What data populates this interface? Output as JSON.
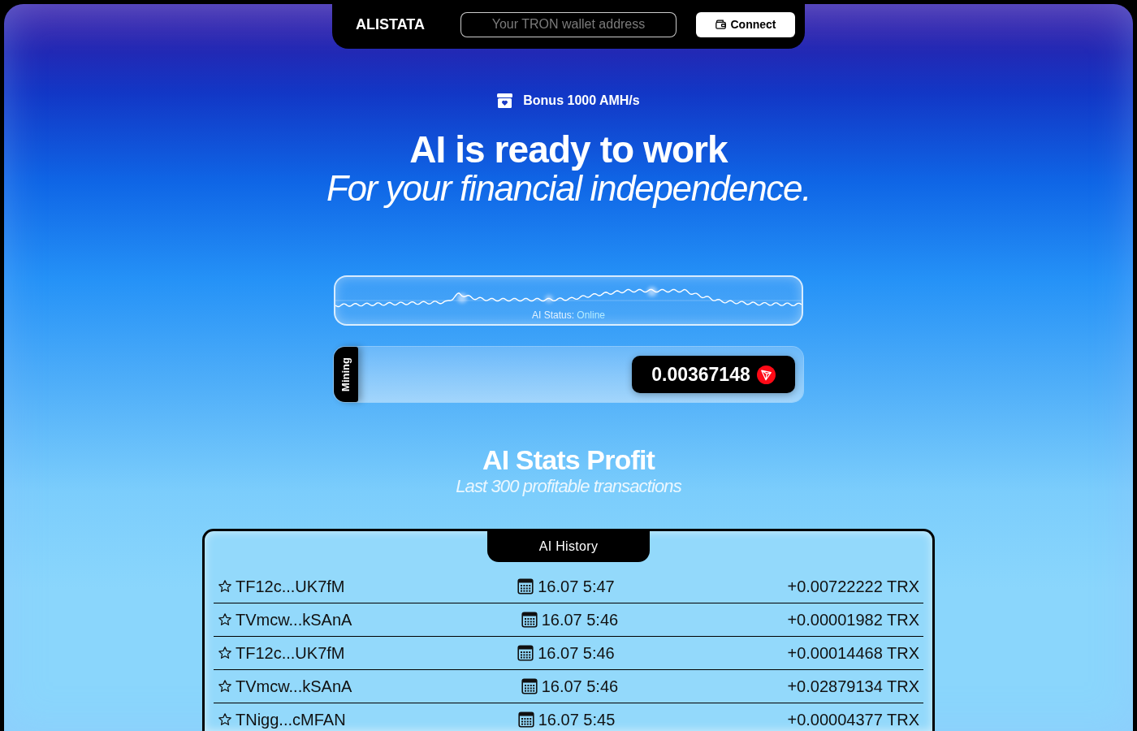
{
  "header": {
    "logo": "ALISTATA",
    "wallet_field": {
      "placeholder": "Your TRON wallet address"
    },
    "connect_button": "Connect"
  },
  "hero": {
    "bonus": "Bonus 1000 AMH/s",
    "title": "AI is ready to work",
    "subtitle": "For your financial independence."
  },
  "status": {
    "label": "AI Status:",
    "value": "Online"
  },
  "mining": {
    "label": "Mining",
    "balance": "0.00367148"
  },
  "stats": {
    "title": "AI Stats Profit",
    "subtitle": "Last 300 profitable transactions"
  },
  "history": {
    "heading": "AI History",
    "rows": [
      {
        "address": "TF12c...UK7fM",
        "time": "16.07 5:47",
        "amount": "+0.00722222 TRX"
      },
      {
        "address": "TVmcw...kSAnA",
        "time": "16.07 5:46",
        "amount": "+0.00001982 TRX"
      },
      {
        "address": "TF12c...UK7fM",
        "time": "16.07 5:46",
        "amount": "+0.00014468 TRX"
      },
      {
        "address": "TVmcw...kSAnA",
        "time": "16.07 5:46",
        "amount": "+0.02879134 TRX"
      },
      {
        "address": "TNigg...cMFAN",
        "time": "16.07 5:45",
        "amount": "+0.00004377 TRX"
      }
    ]
  }
}
